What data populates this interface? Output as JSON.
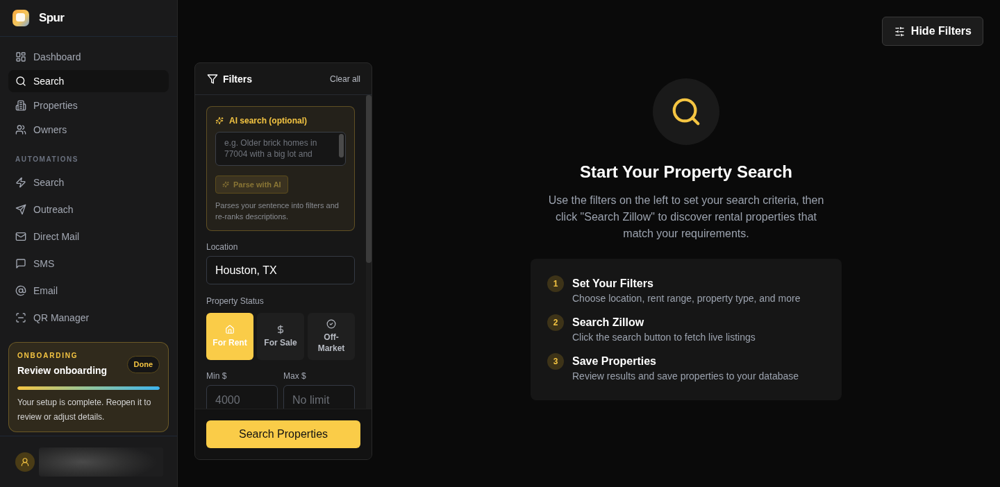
{
  "sidebar": {
    "brand": "Spur",
    "nav": [
      {
        "label": "Dashboard",
        "selected": false
      },
      {
        "label": "Search",
        "selected": true
      },
      {
        "label": "Properties",
        "selected": false
      },
      {
        "label": "Owners",
        "selected": false
      }
    ],
    "automations": {
      "label": "AUTOMATIONS",
      "items": [
        {
          "label": "Search",
          "selected": false
        },
        {
          "label": "Outreach",
          "selected": false
        },
        {
          "label": "Direct Mail",
          "selected": false
        },
        {
          "label": "SMS",
          "selected": false
        },
        {
          "label": "Email",
          "selected": false
        },
        {
          "label": "QR Manager",
          "selected": false
        }
      ]
    },
    "onboarding": {
      "eyebrow": "ONBOARDING",
      "title": "Review onboarding",
      "badge": "Done",
      "level": 1,
      "description": "Your setup is complete. Reopen it to review or adjust details."
    }
  },
  "top_bar": {
    "hide_filters_button": "Hide Filters"
  },
  "filters": {
    "title": "Filters",
    "clear_all": "Clear all",
    "ai_search": {
      "title": "AI search (optional)",
      "placeholder": "e.g. Older brick homes in 77004 with a big lot and",
      "parse_button": {
        "label": "Parse with AI",
        "disabled": true
      },
      "help": "Parses your sentence into filters and re-ranks descriptions."
    },
    "location": {
      "label": "Location",
      "value": "Houston, TX"
    },
    "property_status": {
      "label": "Property Status",
      "options": [
        {
          "label": "For Rent",
          "selected": true
        },
        {
          "label": "For Sale",
          "selected": false
        },
        {
          "label": "Off-Market",
          "selected": false
        }
      ]
    },
    "price": [
      {
        "label": "Min $",
        "placeholder": "4000"
      },
      {
        "label": "Max $",
        "placeholder": "No limit"
      }
    ],
    "search_button": "Search Properties"
  },
  "empty_state": {
    "title": "Start Your Property Search",
    "description": "Use the filters on the left to set your search criteria, then click \"Search Zillow\" to discover rental properties that match your requirements.",
    "steps": [
      {
        "number": "1",
        "title": "Set Your Filters",
        "description": "Choose location, rent range, property type, and more"
      },
      {
        "number": "2",
        "title": "Search Zillow",
        "description": "Click the search button to fetch live listings"
      },
      {
        "number": "3",
        "title": "Save Properties",
        "description": "Review results and save properties to your database"
      }
    ]
  }
}
